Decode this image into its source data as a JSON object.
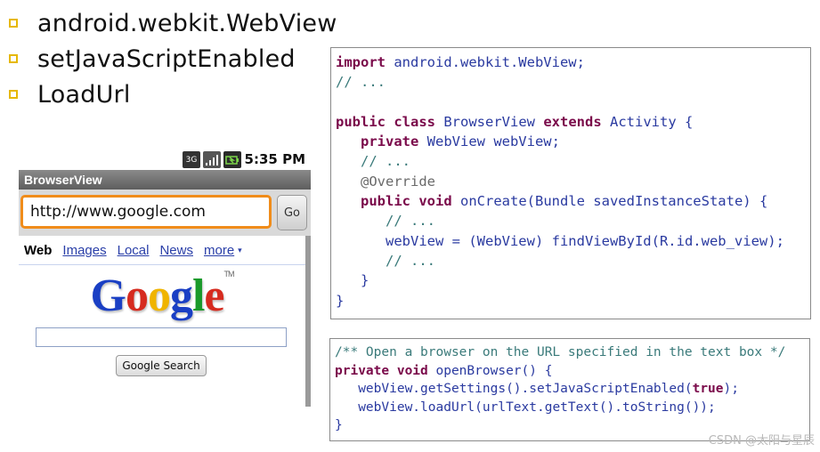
{
  "bullets": [
    {
      "text": "android.webkit.WebView"
    },
    {
      "text": "setJavaScriptEnabled"
    },
    {
      "text": "LoadUrl"
    }
  ],
  "colors": {
    "bullet_marker": "#e6b800",
    "url_focus": "#f08c1a",
    "code_text": "#2a3aa0",
    "keyword": "#7a0a4a",
    "comment": "#3a7a7a"
  },
  "phone": {
    "status": {
      "network": "3G",
      "battery_icon": "battery-icon",
      "signal_icon": "signal-icon",
      "time": "5:35 PM"
    },
    "title": "BrowserView",
    "url_value": "http://www.google.com",
    "go_label": "Go",
    "google": {
      "nav_active": "Web",
      "nav_links": [
        "Images",
        "Local",
        "News",
        "more"
      ],
      "more_arrow": "▾",
      "logo_letters": [
        "G",
        "o",
        "o",
        "g",
        "l",
        "e"
      ],
      "logo_tm": "TM",
      "search_value": "",
      "search_button": "Google Search"
    }
  },
  "code_a": {
    "l1_kw": "import",
    "l1_rest": " android.webkit.WebView;",
    "l2": "// ...",
    "l4_kw1": "public",
    "l4_kw2": "class",
    "l4_mid": " BrowserView ",
    "l4_kw3": "extends",
    "l4_rest": " Activity {",
    "l5_kw": "private",
    "l5_rest": " WebView webView;",
    "l6": "// ...",
    "l7": "@Override",
    "l8_kw1": "public",
    "l8_kw2": "void",
    "l8_rest": " onCreate(Bundle savedInstanceState) {",
    "l9": "// ...",
    "l10": "webView = (WebView) findViewById(R.id.web_view);",
    "l11": "// ...",
    "l12": "}",
    "l13": "}"
  },
  "code_b": {
    "l1": "/** Open a browser on the URL specified in the text box */",
    "l2_kw1": "private",
    "l2_kw2": "void",
    "l2_rest": " openBrowser() {",
    "l3_pre": "webView.getSettings().setJavaScriptEnabled(",
    "l3_kw": "true",
    "l3_post": ");",
    "l4": "webView.loadUrl(urlText.getText().toString());",
    "l5": "}"
  },
  "watermark": "CSDN @太阳与星辰"
}
